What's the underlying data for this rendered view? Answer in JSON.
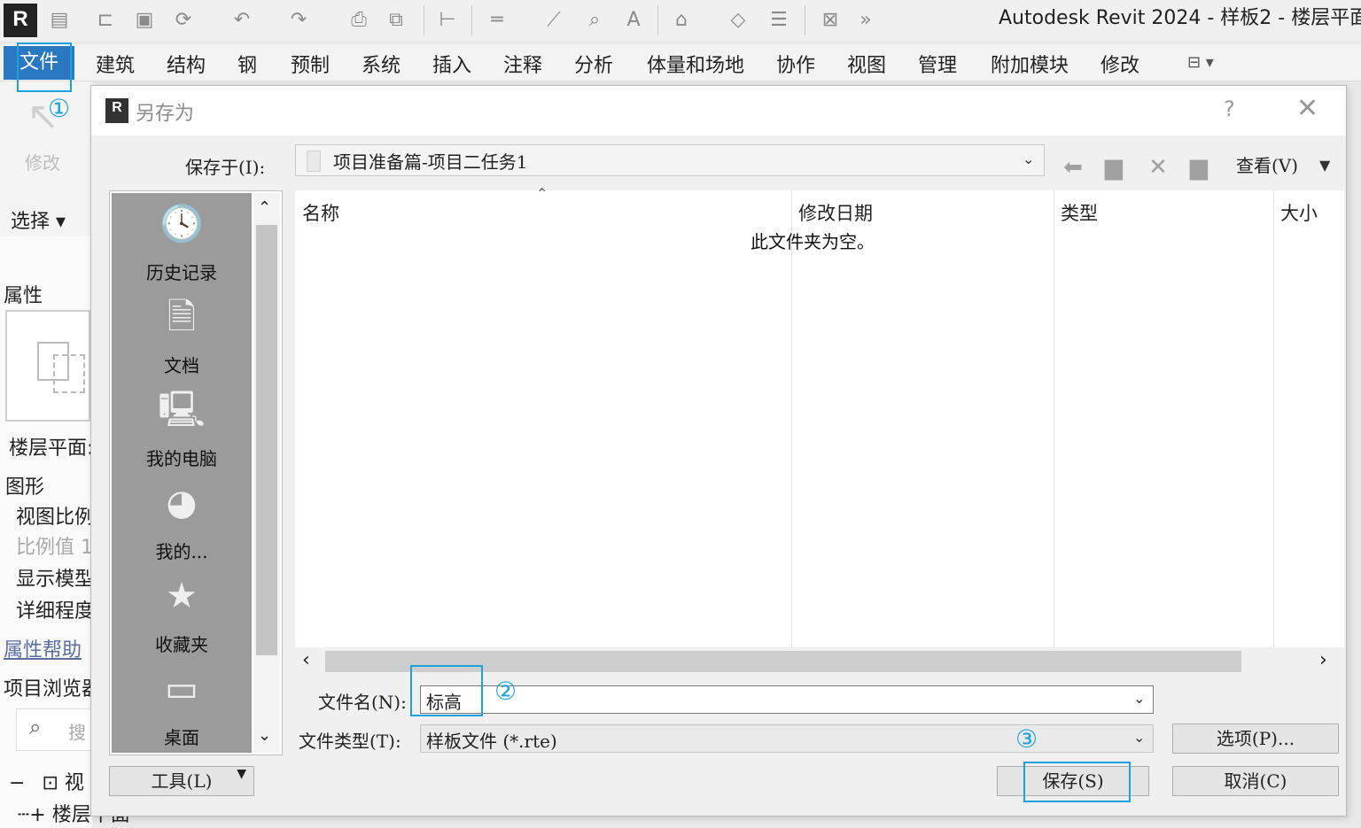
{
  "app": {
    "title": "Autodesk Revit 2024 - 样板2 - 楼层平面:",
    "logo": "R"
  },
  "ribbon": {
    "tabs": [
      "文件",
      "建筑",
      "结构",
      "钢",
      "预制",
      "系统",
      "插入",
      "注释",
      "分析",
      "体量和场地",
      "协作",
      "视图",
      "管理",
      "附加模块",
      "修改"
    ],
    "modify_label": "修改",
    "select_label": "选择 ▾"
  },
  "properties": {
    "title": "属性",
    "floor_plan": "楼层平面:",
    "graphics": "图形",
    "view_scale": "视图比例",
    "scale_value": "比例值 1",
    "display_model": "显示模型",
    "detail_level": "详细程度",
    "help_link": "属性帮助",
    "project_browser": "项目浏览器",
    "search": "搜",
    "tree_views": "视",
    "tree_floor": "楼层平面"
  },
  "dialog": {
    "title": "另存为",
    "help": "?",
    "save_in_label": "保存于(I):",
    "save_in_value": "项目准备篇-项目二任务1",
    "view_label": "查看(V)",
    "columns": [
      "名称",
      "修改日期",
      "类型",
      "大小"
    ],
    "empty_message": "此文件夹为空。",
    "places": [
      {
        "label": "历史记录",
        "icon": "history-icon"
      },
      {
        "label": "文档",
        "icon": "documents-icon"
      },
      {
        "label": "我的电脑",
        "icon": "computer-icon"
      },
      {
        "label": "我的...",
        "icon": "network-icon"
      },
      {
        "label": "收藏夹",
        "icon": "favorites-icon"
      },
      {
        "label": "桌面",
        "icon": "desktop-icon"
      }
    ],
    "filename_label": "文件名(N):",
    "filename_value": "标高",
    "filetype_label": "文件类型(T):",
    "filetype_value": "样板文件 (*.rte)",
    "tools_button": "工具(L)",
    "options_button": "选项(P)...",
    "save_button": "保存(S)",
    "cancel_button": "取消(C)"
  },
  "annotations": {
    "step1": "①",
    "step2": "②",
    "step3": "③",
    "color": "#1aa3e0"
  }
}
